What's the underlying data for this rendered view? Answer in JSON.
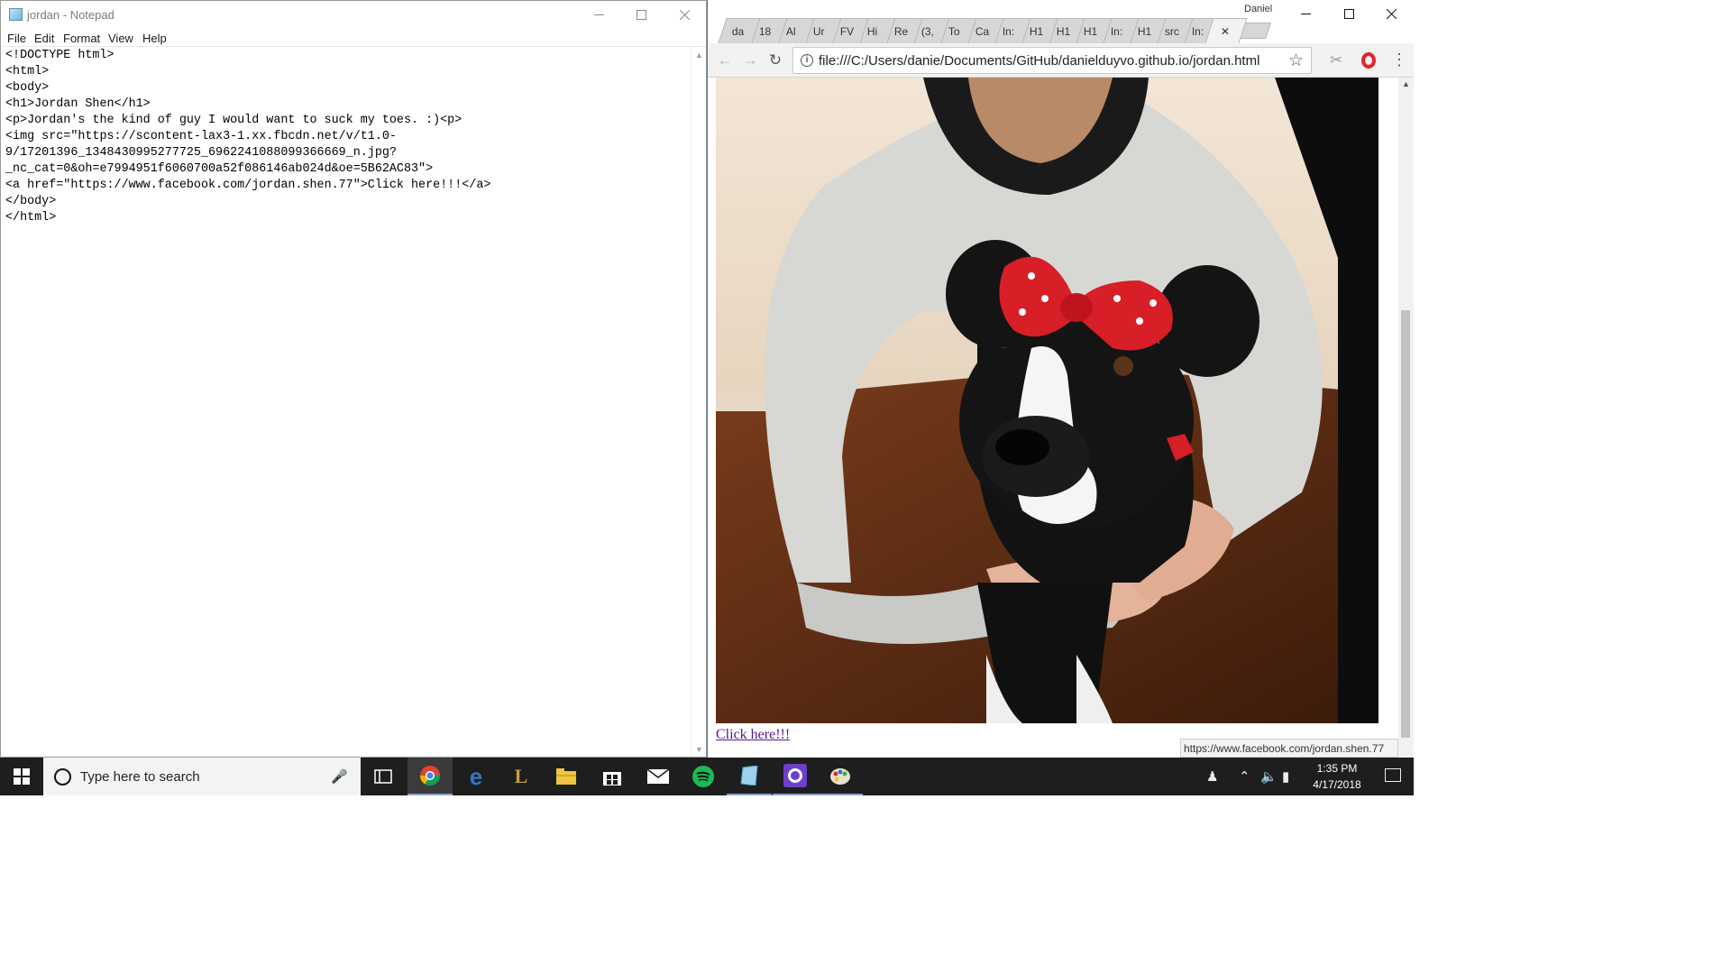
{
  "notepad": {
    "title": "jordan - Notepad",
    "menu": [
      "File",
      "Edit",
      "Format",
      "View",
      "Help"
    ],
    "content": "<!DOCTYPE html>\n<html>\n<body>\n<h1>Jordan Shen</h1>\n<p>Jordan's the kind of guy I would want to suck my toes. :)<p>\n<img src=\"https://scontent-lax3-1.xx.fbcdn.net/v/t1.0-\n9/17201396_1348430995277725_6962241088099366669_n.jpg?\n_nc_cat=0&oh=e7994951f6060700a52f086146ab024d&oe=5B62AC83\">\n<a href=\"https://www.facebook.com/jordan.shen.77\">Click here!!!</a>\n</body>\n</html>"
  },
  "chrome": {
    "profile_name": "Daniel",
    "tabs": [
      "da",
      "18",
      "Al",
      "Ur",
      "FV",
      "Hi",
      "Re",
      "(3,",
      "To",
      "Ca",
      "In:",
      "H1",
      "H1",
      "H1",
      "In:",
      "H1",
      "src",
      "In:",
      ""
    ],
    "active_tab_index": 18,
    "url": "file:///C:/Users/danie/Documents/GitHub/danielduyvo.github.io/jordan.html",
    "link_text": "Click here!!!",
    "status_url": "https://www.facebook.com/jordan.shen.77"
  },
  "taskbar": {
    "search_placeholder": "Type here to search",
    "apps": [
      "task-view",
      "chrome",
      "edge",
      "league-of-legends",
      "file-explorer",
      "microsoft-store",
      "mail",
      "spotify",
      "notepad",
      "github-desktop",
      "paint"
    ],
    "time": "1:35 PM",
    "date": "4/17/2018"
  },
  "colors": {
    "link_visited": "#551a8b",
    "taskbar_bg": "#1e1e1e",
    "chrome_toolbar": "#f2f2f2",
    "opera_red": "#e3232b",
    "spotify_green": "#1db954"
  }
}
